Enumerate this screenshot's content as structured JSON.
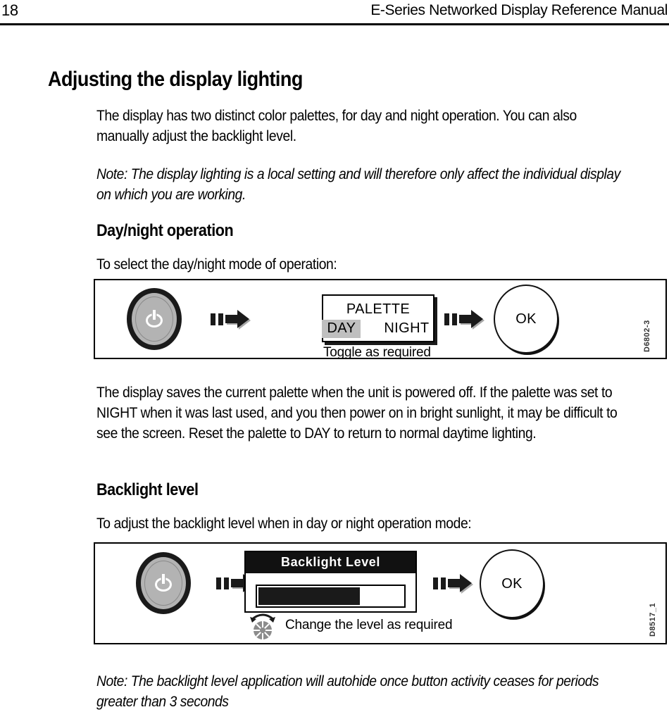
{
  "header": {
    "page_number": "18",
    "manual_title": "E-Series Networked Display Reference Manual"
  },
  "content": {
    "heading": "Adjusting the display lighting",
    "intro_paragraph": "The display has two distinct color palettes, for day and night operation. You can also manually adjust the backlight level.",
    "note_1": "Note: The display lighting is a local setting and will therefore only affect the individual display on which you are working.",
    "section_daynight": {
      "heading": "Day/night operation",
      "lead_in": "To select the day/night mode of operation:",
      "after_paragraph": "The display saves the current palette when the unit is powered off. If the palette was set to NIGHT when it was last used, and you then power on in bright sunlight, it may be difficult to see the screen. Reset the palette to DAY to return to normal daytime lighting."
    },
    "section_backlight": {
      "heading": "Backlight level",
      "lead_in": "To adjust the backlight level when in day or night operation mode:",
      "note": "Note: The backlight level application will autohide once button activity ceases for periods greater than 3 seconds"
    }
  },
  "figure_daynight": {
    "power_button_label": "power-button",
    "palette": {
      "title": "PALETTE",
      "option_day": "DAY",
      "option_night": "NIGHT",
      "selected": "DAY"
    },
    "caption": "Toggle as required",
    "confirm_button": "OK",
    "reference_code": "D6802-3"
  },
  "figure_backlight": {
    "power_button_label": "power-button",
    "dialog": {
      "title": "Backlight Level",
      "level_percent": 70
    },
    "caption": "Change the level as required",
    "confirm_button": "OK",
    "reference_code": "D8517_1"
  },
  "colors": {
    "ink": "#000000",
    "paper": "#ffffff",
    "button_gray": "#b3b3b3",
    "highlight_gray": "#bfbfbf",
    "bar_fill": "#1a1a1a"
  }
}
